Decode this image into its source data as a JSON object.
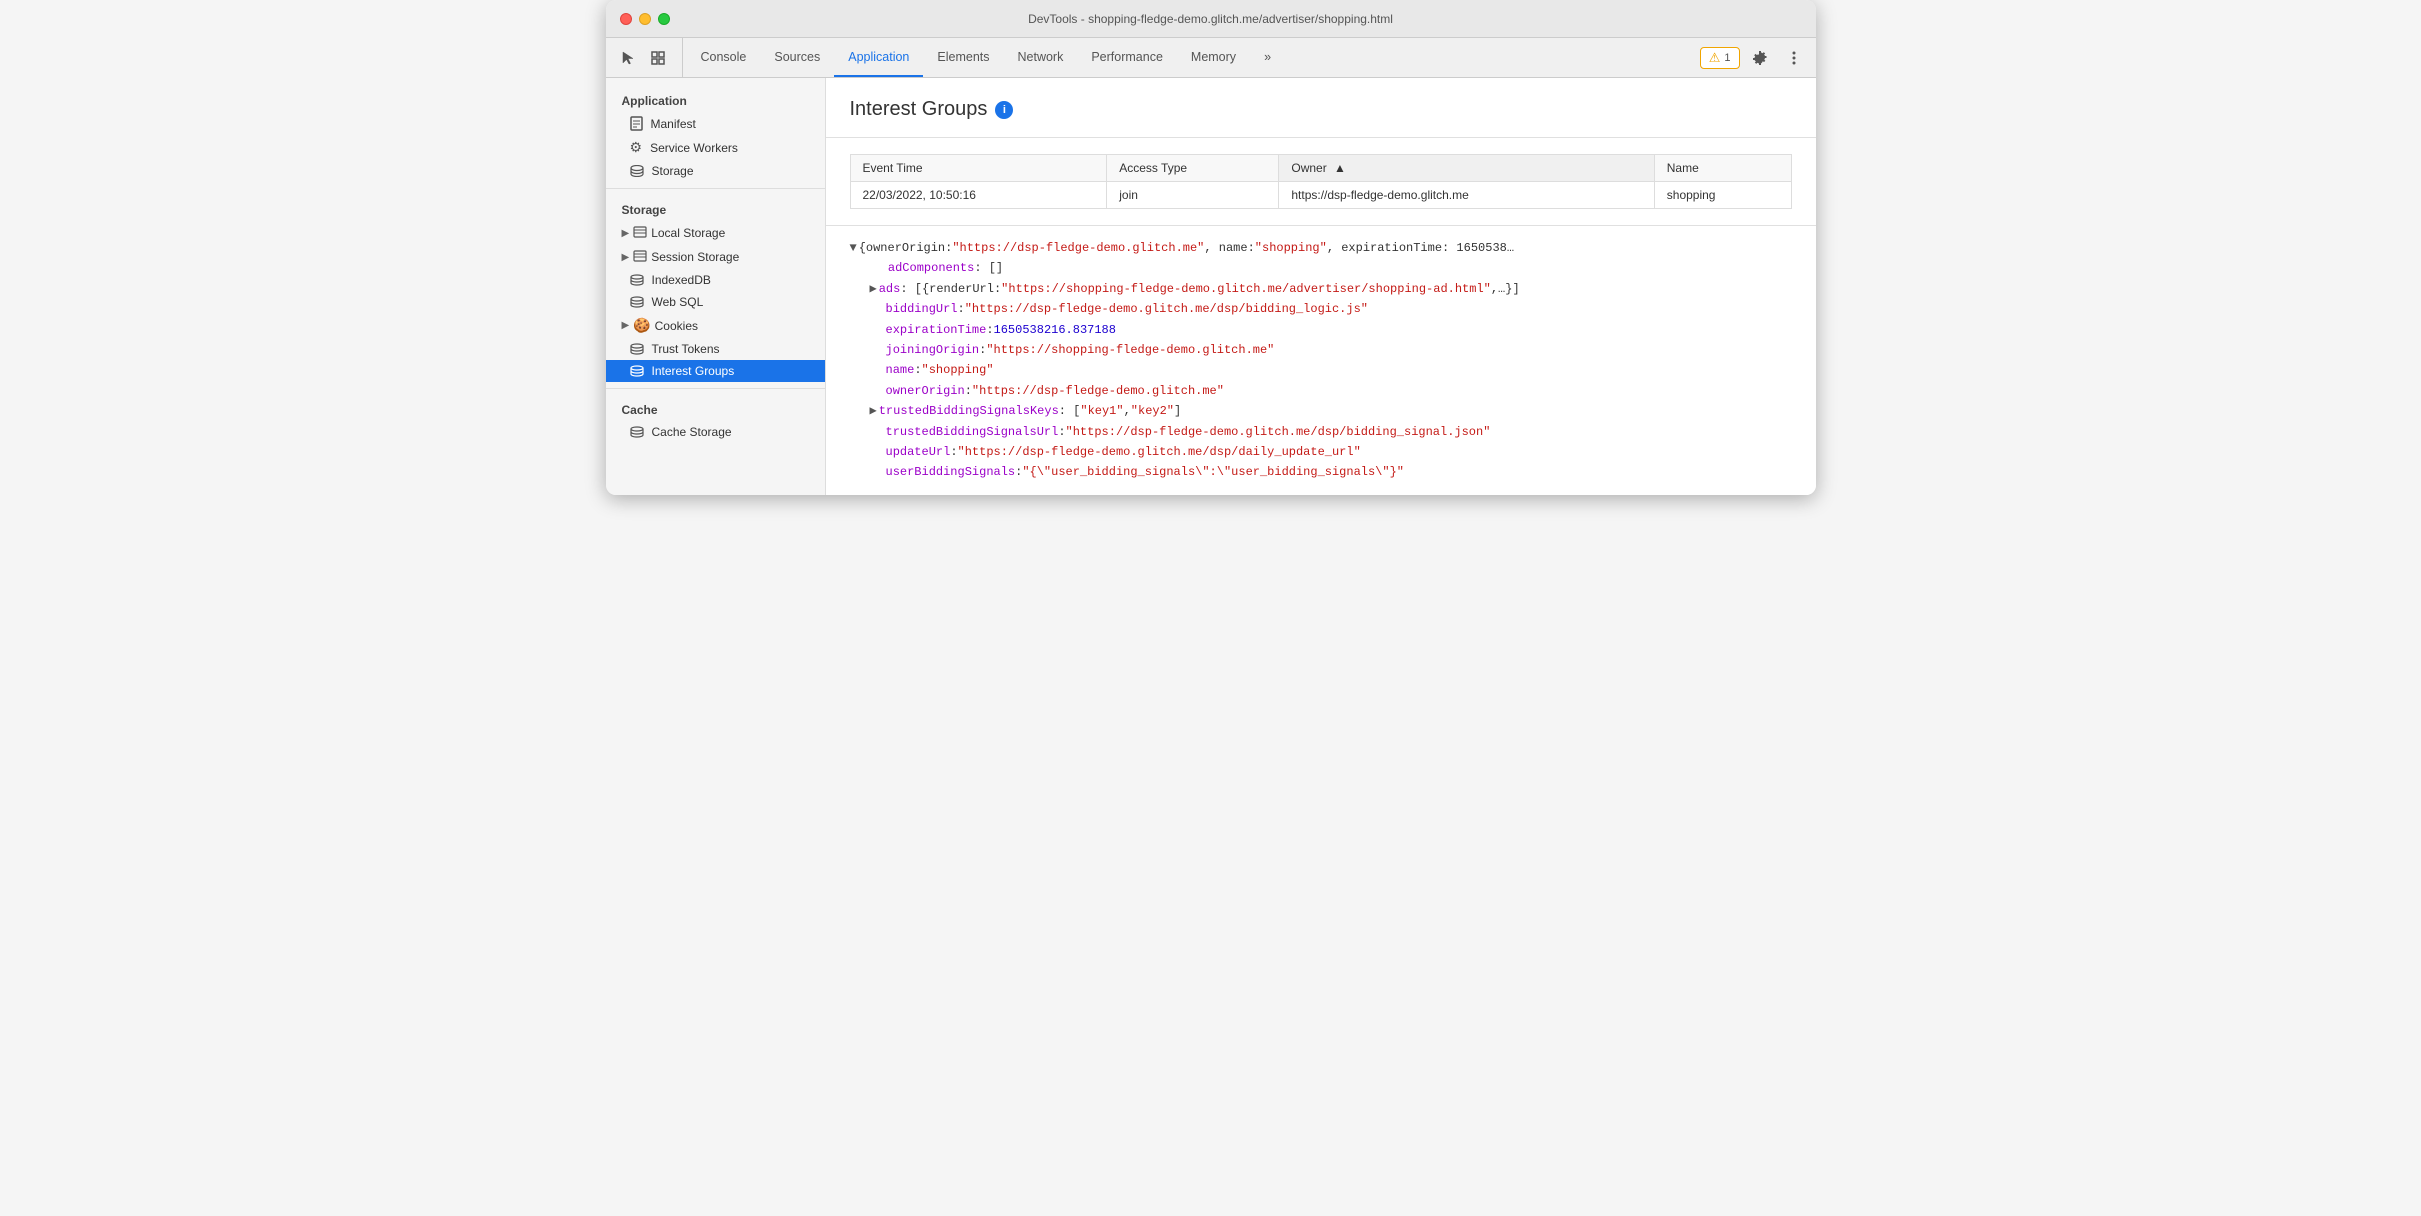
{
  "window": {
    "title": "DevTools - shopping-fledge-demo.glitch.me/advertiser/shopping.html"
  },
  "toolbar": {
    "tabs": [
      {
        "id": "console",
        "label": "Console",
        "active": false
      },
      {
        "id": "sources",
        "label": "Sources",
        "active": false
      },
      {
        "id": "application",
        "label": "Application",
        "active": true
      },
      {
        "id": "elements",
        "label": "Elements",
        "active": false
      },
      {
        "id": "network",
        "label": "Network",
        "active": false
      },
      {
        "id": "performance",
        "label": "Performance",
        "active": false
      },
      {
        "id": "memory",
        "label": "Memory",
        "active": false
      }
    ],
    "warn_count": "1",
    "more_label": "»"
  },
  "sidebar": {
    "sections": [
      {
        "label": "Application",
        "items": [
          {
            "id": "manifest",
            "label": "Manifest",
            "icon": "📄",
            "indent": true
          },
          {
            "id": "service-workers",
            "label": "Service Workers",
            "icon": "⚙️",
            "indent": true
          },
          {
            "id": "storage-top",
            "label": "Storage",
            "icon": "🗄️",
            "indent": true
          }
        ]
      },
      {
        "label": "Storage",
        "items": [
          {
            "id": "local-storage",
            "label": "Local Storage",
            "icon": "▦",
            "group": true,
            "indent": false
          },
          {
            "id": "session-storage",
            "label": "Session Storage",
            "icon": "▦",
            "group": true,
            "indent": false
          },
          {
            "id": "indexeddb",
            "label": "IndexedDB",
            "icon": "🗄️",
            "indent": false
          },
          {
            "id": "web-sql",
            "label": "Web SQL",
            "icon": "🗄️",
            "indent": false
          },
          {
            "id": "cookies",
            "label": "Cookies",
            "icon": "🍪",
            "group": true,
            "indent": false
          },
          {
            "id": "trust-tokens",
            "label": "Trust Tokens",
            "icon": "🗄️",
            "indent": false
          },
          {
            "id": "interest-groups",
            "label": "Interest Groups",
            "icon": "🗄️",
            "indent": false,
            "active": true
          }
        ]
      },
      {
        "label": "Cache",
        "items": [
          {
            "id": "cache-storage",
            "label": "Cache Storage",
            "icon": "🗄️",
            "indent": false
          }
        ]
      }
    ]
  },
  "main": {
    "title": "Interest Groups",
    "table": {
      "columns": [
        {
          "id": "event-time",
          "label": "Event Time",
          "sorted": false
        },
        {
          "id": "access-type",
          "label": "Access Type",
          "sorted": false
        },
        {
          "id": "owner",
          "label": "Owner",
          "sorted": true,
          "sort_dir": "asc"
        },
        {
          "id": "name",
          "label": "Name",
          "sorted": false
        }
      ],
      "rows": [
        {
          "event_time": "22/03/2022, 10:50:16",
          "access_type": "join",
          "owner": "https://dsp-fledge-demo.glitch.me",
          "name": "shopping"
        }
      ]
    },
    "json_viewer": {
      "lines": [
        {
          "type": "object-start",
          "indent": 0,
          "content": "{ownerOrigin: \"https://dsp-fledge-demo.glitch.me\", name: \"shopping\", expirationTime: 1650538..."
        },
        {
          "type": "key-value",
          "indent": 1,
          "key": "adComponents",
          "plain": ": []"
        },
        {
          "type": "key-group",
          "indent": 1,
          "key": "ads",
          "plain": ": [{renderUrl: \"https://shopping-fledge-demo.glitch.me/advertiser/shopping-ad.html\",...}]"
        },
        {
          "type": "key-string",
          "indent": 1,
          "key": "biddingUrl",
          "value": "\"https://dsp-fledge-demo.glitch.me/dsp/bidding_logic.js\""
        },
        {
          "type": "key-number",
          "indent": 1,
          "key": "expirationTime",
          "value": "1650538216.837188"
        },
        {
          "type": "key-string",
          "indent": 1,
          "key": "joiningOrigin",
          "value": "\"https://shopping-fledge-demo.glitch.me\""
        },
        {
          "type": "key-string",
          "indent": 1,
          "key": "name",
          "value": "\"shopping\""
        },
        {
          "type": "key-string",
          "indent": 1,
          "key": "ownerOrigin",
          "value": "\"https://dsp-fledge-demo.glitch.me\""
        },
        {
          "type": "key-group",
          "indent": 1,
          "key": "trustedBiddingSignalsKeys",
          "plain": ": [\"key1\", \"key2\"]"
        },
        {
          "type": "key-string",
          "indent": 1,
          "key": "trustedBiddingSignalsUrl",
          "value": "\"https://dsp-fledge-demo.glitch.me/dsp/bidding_signal.json\""
        },
        {
          "type": "key-string",
          "indent": 1,
          "key": "updateUrl",
          "value": "\"https://dsp-fledge-demo.glitch.me/dsp/daily_update_url\""
        },
        {
          "type": "key-string",
          "indent": 1,
          "key": "userBiddingSignals",
          "value": "\"{\\\"user_bidding_signals\\\":\\\"user_bidding_signals\\\"}\""
        }
      ]
    }
  }
}
